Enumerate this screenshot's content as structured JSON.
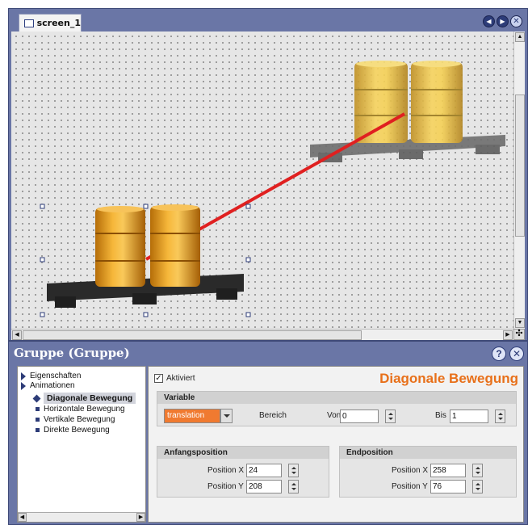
{
  "screen": {
    "tab_label": "screen_1",
    "controls": [
      "back-icon",
      "forward-icon",
      "close-icon"
    ]
  },
  "animation_line_color": "#e02020",
  "props": {
    "title": "Gruppe (Gruppe)",
    "tree": {
      "items": [
        {
          "label": "Eigenschaften",
          "type": "folder"
        },
        {
          "label": "Animationen",
          "type": "folder"
        },
        {
          "label": "Diagonale Bewegung",
          "type": "selected"
        },
        {
          "label": "Horizontale Bewegung",
          "type": "leaf"
        },
        {
          "label": "Vertikale Bewegung",
          "type": "leaf"
        },
        {
          "label": "Direkte Bewegung",
          "type": "leaf"
        }
      ]
    },
    "detail": {
      "activated_label": "Aktiviert",
      "activated": true,
      "section_title": "Diagonale Bewegung",
      "section_title_color": "#e8701a",
      "variable": {
        "header": "Variable",
        "value": "translation",
        "range_label": "Bereich",
        "from_label": "Von",
        "from_value": "0",
        "to_label": "Bis",
        "to_value": "1"
      },
      "start": {
        "header": "Anfangsposition",
        "x_label": "Position X",
        "x_value": "24",
        "y_label": "Position Y",
        "y_value": "208"
      },
      "end": {
        "header": "Endposition",
        "x_label": "Position X",
        "x_value": "258",
        "y_label": "Position Y",
        "y_value": "76"
      }
    }
  }
}
